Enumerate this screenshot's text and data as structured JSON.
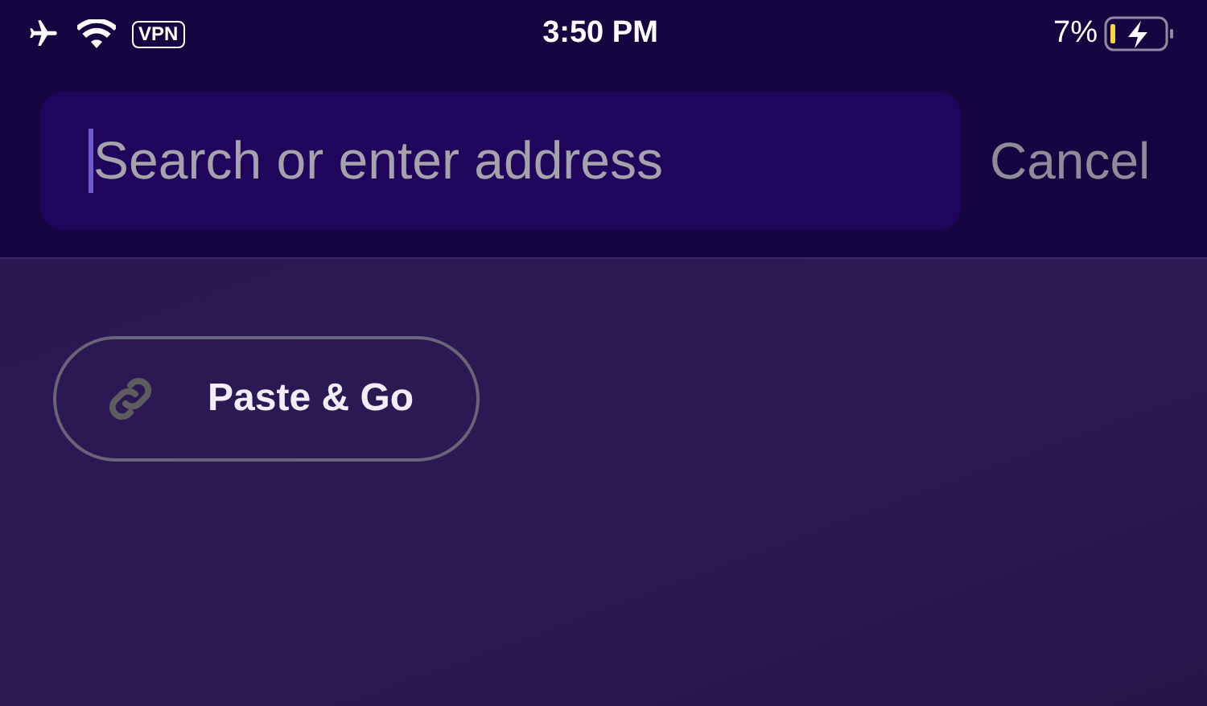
{
  "status_bar": {
    "vpn": "VPN",
    "time": "3:50 PM",
    "battery": "7%"
  },
  "search": {
    "placeholder": "Search or enter address",
    "cancel": "Cancel"
  },
  "actions": [
    {
      "label": "Paste & Go"
    }
  ]
}
